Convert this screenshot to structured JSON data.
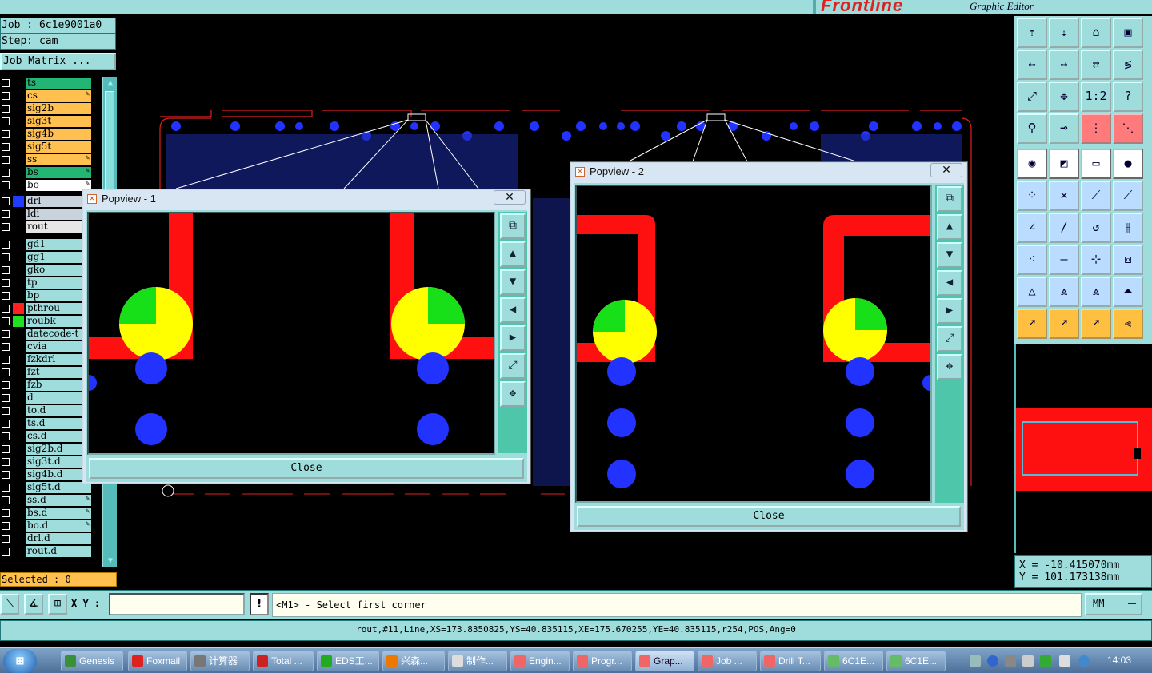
{
  "app": {
    "brand": "Frontline",
    "subtitle": "Graphic Editor"
  },
  "left": {
    "job": "Job : 6c1e9001a0",
    "step": "Step: cam",
    "job_matrix": "Job Matrix ...",
    "selected": "Selected : 0",
    "layers": [
      {
        "name": "ts",
        "color": "#22b573",
        "mark": "",
        "swatch": ""
      },
      {
        "name": "cs",
        "color": "#ffc050",
        "mark": "✎",
        "swatch": ""
      },
      {
        "name": "sig2b",
        "color": "#ffc050",
        "mark": "",
        "swatch": ""
      },
      {
        "name": "sig3t",
        "color": "#ffc050",
        "mark": "",
        "swatch": ""
      },
      {
        "name": "sig4b",
        "color": "#ffc050",
        "mark": "",
        "swatch": ""
      },
      {
        "name": "sig5t",
        "color": "#ffc050",
        "mark": "",
        "swatch": ""
      },
      {
        "name": "ss",
        "color": "#ffc050",
        "mark": "✎",
        "swatch": ""
      },
      {
        "name": "bs",
        "color": "#22b573",
        "mark": "✎",
        "swatch": ""
      },
      {
        "name": "bo",
        "color": "#ffffff",
        "mark": "✎",
        "swatch": ""
      },
      {
        "name": "drl",
        "color": "#c9d3dd",
        "mark": "",
        "swatch": "#1f3cff"
      },
      {
        "name": "ldi",
        "color": "#c9d3dd",
        "mark": "",
        "swatch": ""
      },
      {
        "name": "rout",
        "color": "#e6e6e6",
        "mark": "",
        "swatch": ""
      },
      {
        "name": "gd1",
        "color": "#9fdcdc",
        "mark": "",
        "swatch": ""
      },
      {
        "name": "gg1",
        "color": "#9fdcdc",
        "mark": "",
        "swatch": ""
      },
      {
        "name": "gko",
        "color": "#9fdcdc",
        "mark": "",
        "swatch": ""
      },
      {
        "name": "tp",
        "color": "#9fdcdc",
        "mark": "",
        "swatch": ""
      },
      {
        "name": "bp",
        "color": "#9fdcdc",
        "mark": "",
        "swatch": ""
      },
      {
        "name": "pthrou",
        "color": "#9fdcdc",
        "mark": "",
        "swatch": "#ff2020"
      },
      {
        "name": "roubk",
        "color": "#9fdcdc",
        "mark": "",
        "swatch": "#20e020"
      },
      {
        "name": "datecode-t",
        "color": "#9fdcdc",
        "mark": "",
        "swatch": ""
      },
      {
        "name": "cvia",
        "color": "#9fdcdc",
        "mark": "",
        "swatch": ""
      },
      {
        "name": "fzkdrl",
        "color": "#9fdcdc",
        "mark": "",
        "swatch": ""
      },
      {
        "name": "fzt",
        "color": "#9fdcdc",
        "mark": "",
        "swatch": ""
      },
      {
        "name": "fzb",
        "color": "#9fdcdc",
        "mark": "",
        "swatch": ""
      },
      {
        "name": "d",
        "color": "#9fdcdc",
        "mark": "",
        "swatch": ""
      },
      {
        "name": "to.d",
        "color": "#9fdcdc",
        "mark": "",
        "swatch": ""
      },
      {
        "name": "ts.d",
        "color": "#9fdcdc",
        "mark": "",
        "swatch": ""
      },
      {
        "name": "cs.d",
        "color": "#9fdcdc",
        "mark": "",
        "swatch": ""
      },
      {
        "name": "sig2b.d",
        "color": "#9fdcdc",
        "mark": "",
        "swatch": ""
      },
      {
        "name": "sig3t.d",
        "color": "#9fdcdc",
        "mark": "",
        "swatch": ""
      },
      {
        "name": "sig4b.d",
        "color": "#9fdcdc",
        "mark": "",
        "swatch": ""
      },
      {
        "name": "sig5t.d",
        "color": "#9fdcdc",
        "mark": "",
        "swatch": ""
      },
      {
        "name": "ss.d",
        "color": "#9fdcdc",
        "mark": "✎",
        "swatch": ""
      },
      {
        "name": "bs.d",
        "color": "#9fdcdc",
        "mark": "✎",
        "swatch": ""
      },
      {
        "name": "bo.d",
        "color": "#9fdcdc",
        "mark": "✎",
        "swatch": ""
      },
      {
        "name": "drl.d",
        "color": "#9fdcdc",
        "mark": "",
        "swatch": ""
      },
      {
        "name": "rout.d",
        "color": "#9fdcdc",
        "mark": "",
        "swatch": ""
      }
    ]
  },
  "popview1": {
    "title": "Popview - 1",
    "close_label": "Close"
  },
  "popview2": {
    "title": "Popview - 2",
    "close_label": "Close"
  },
  "coords": {
    "x": "X = -10.415070mm",
    "y": "Y = 101.173138mm"
  },
  "command": {
    "xy_label": "X Y :",
    "xy_value": "",
    "warn": "!",
    "prompt": "<M1> - Select first corner",
    "units": "MM"
  },
  "status_line": "rout,#11,Line,XS=173.8350825,YS=40.835115,XE=175.670255,YE=40.835115,r254,POS,Ang=0",
  "taskbar": {
    "items": [
      {
        "label": "Genesis",
        "icon_color": "#3a8f3a",
        "active": false
      },
      {
        "label": "Foxmail",
        "icon_color": "#d22",
        "active": false
      },
      {
        "label": "计算器",
        "icon_color": "#777",
        "active": false
      },
      {
        "label": "Total ...",
        "icon_color": "#c22",
        "active": false
      },
      {
        "label": "EDS工...",
        "icon_color": "#2a2",
        "active": false
      },
      {
        "label": "兴森...",
        "icon_color": "#e70",
        "active": false
      },
      {
        "label": "制作...",
        "icon_color": "#ddd",
        "active": false
      },
      {
        "label": "Engin...",
        "icon_color": "#e66",
        "active": false
      },
      {
        "label": "Progr...",
        "icon_color": "#e66",
        "active": false
      },
      {
        "label": "Grap...",
        "icon_color": "#e66",
        "active": true
      },
      {
        "label": "Job ...",
        "icon_color": "#e66",
        "active": false
      },
      {
        "label": "Drill T...",
        "icon_color": "#e66",
        "active": false
      },
      {
        "label": "6C1E...",
        "icon_color": "#6b6",
        "active": false
      },
      {
        "label": "6C1E...",
        "icon_color": "#6b6",
        "active": false
      }
    ],
    "clock": "14:03"
  }
}
